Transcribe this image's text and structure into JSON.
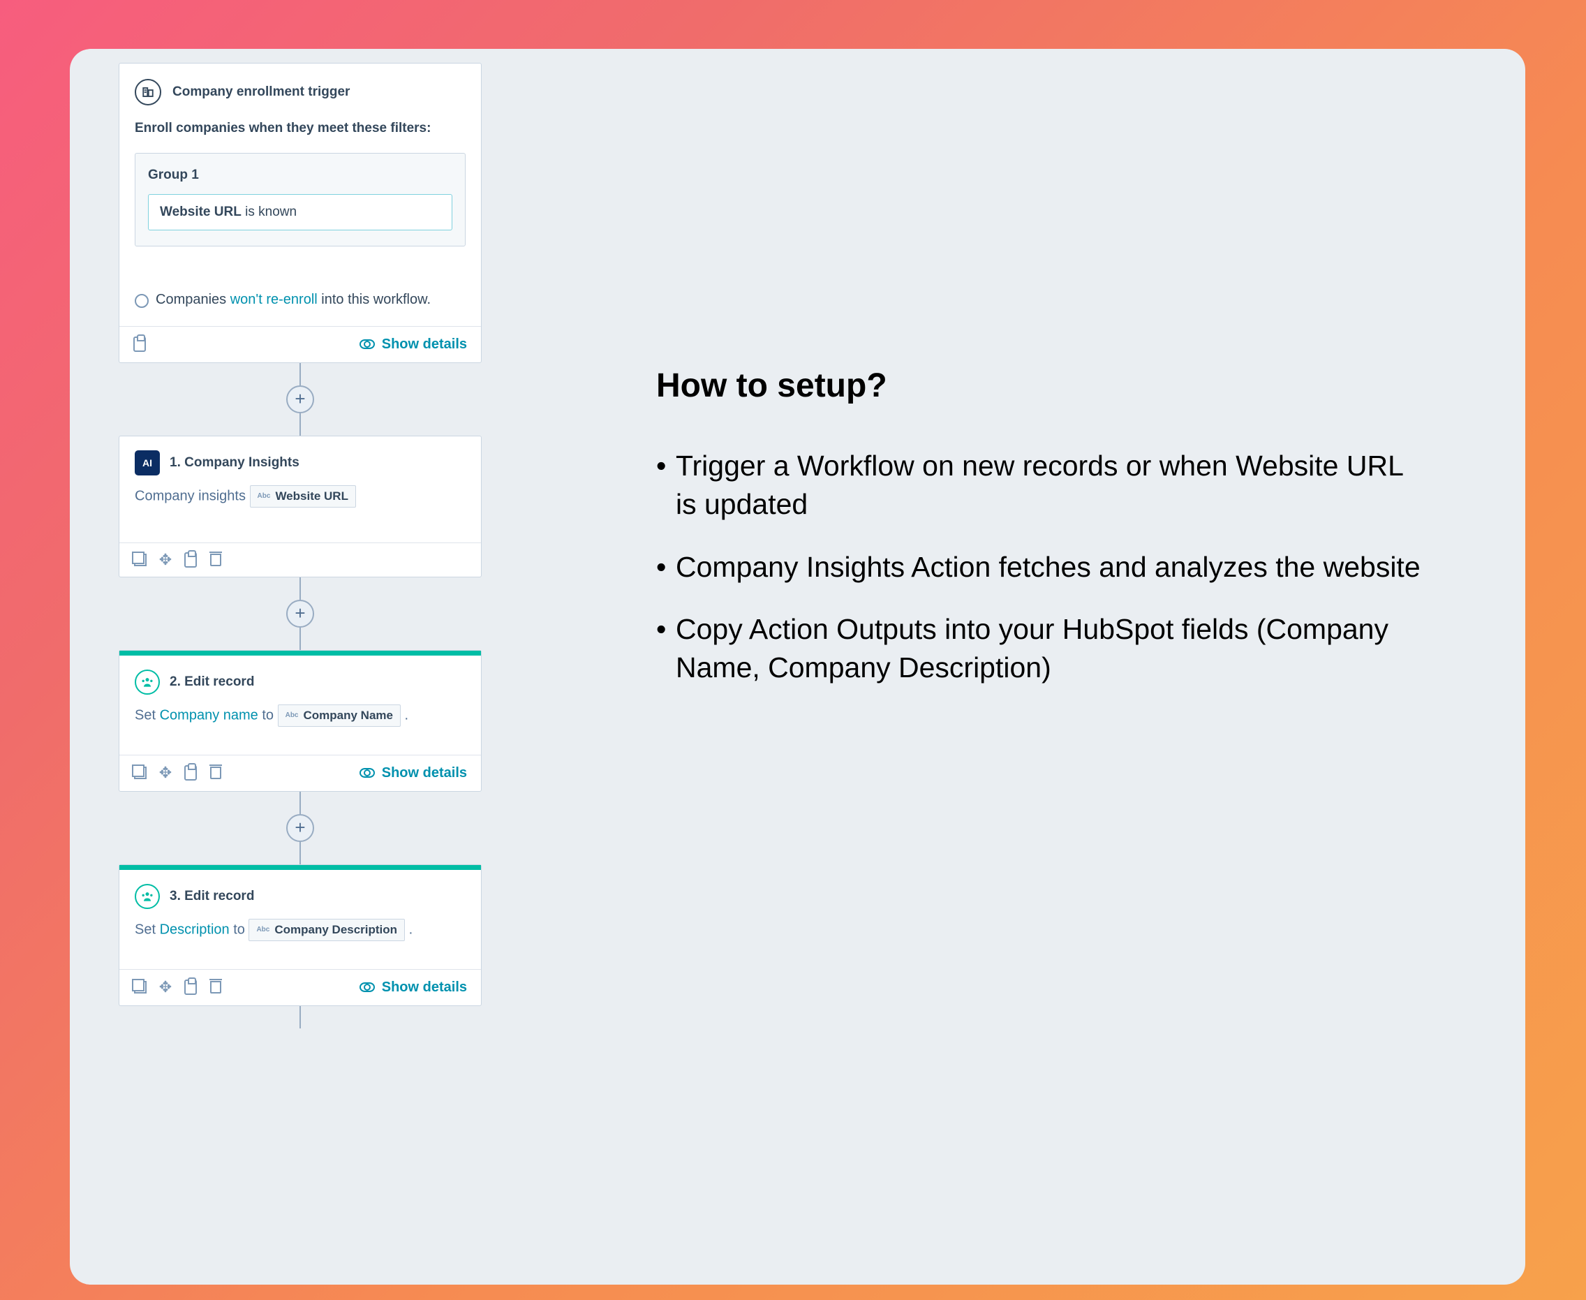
{
  "right": {
    "heading": "How to setup?",
    "bullets": [
      "Trigger a Workflow on new records or when Website URL is updated",
      "Company Insights Action fetches and analyzes the website",
      "Copy Action Outputs into your HubSpot fields (Company Name, Company Description)"
    ]
  },
  "trigger": {
    "title": "Company enrollment trigger",
    "desc": "Enroll companies when they meet these filters:",
    "group_label": "Group 1",
    "filter_prop": "Website URL",
    "filter_cond": "is known",
    "reenroll_pre": "Companies",
    "reenroll_link": "won't re-enroll",
    "reenroll_post": "into this workflow.",
    "show_details": "Show details"
  },
  "step1": {
    "title": "1. Company Insights",
    "label": "Company insights",
    "token": "Website URL",
    "abc": "Abc"
  },
  "step2": {
    "title": "2. Edit record",
    "set": "Set",
    "field": "Company name",
    "to": "to",
    "token": "Company Name",
    "abc": "Abc",
    "show_details": "Show details"
  },
  "step3": {
    "title": "3. Edit record",
    "set": "Set",
    "field": "Description",
    "to": "to",
    "token": "Company Description",
    "abc": "Abc",
    "show_details": "Show details"
  },
  "icons": {
    "ai": "AI"
  }
}
